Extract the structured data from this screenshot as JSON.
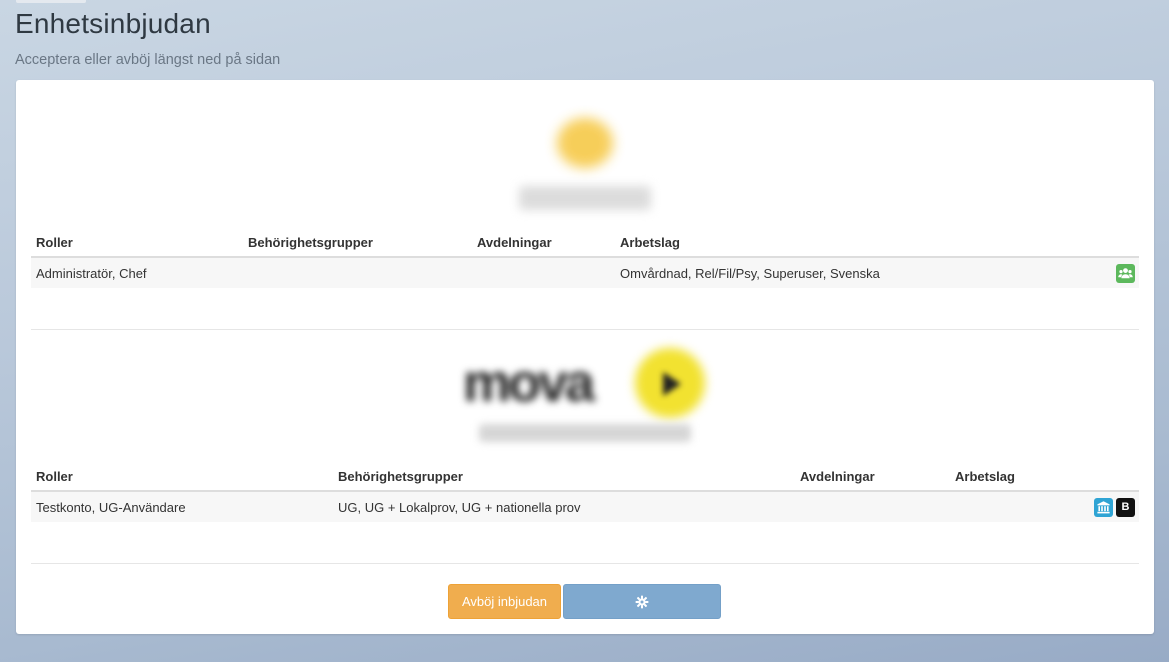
{
  "page": {
    "title": "Enhetsinbjudan",
    "subtitle": "Acceptera eller avböj längst ned på sidan"
  },
  "units": [
    {
      "columns": [
        "Roller",
        "Behörighetsgrupper",
        "Avdelningar",
        "Arbetslag"
      ],
      "row": {
        "roller": "Administratör, Chef",
        "behorighetsgrupper": "",
        "avdelningar": "",
        "arbetslag": "Omvårdnad, Rel/Fil/Psy, Superuser, Svenska"
      },
      "icons": [
        "users-icon"
      ]
    },
    {
      "columns": [
        "Roller",
        "Behörighetsgrupper",
        "Avdelningar",
        "Arbetslag"
      ],
      "row": {
        "roller": "Testkonto, UG-Användare",
        "behorighetsgrupper": "UG, UG + Lokalprov, UG + nationella prov",
        "avdelningar": "",
        "arbetslag": ""
      },
      "icons": [
        "bank-icon",
        "b-badge-icon"
      ],
      "badge_letter": "B"
    }
  ],
  "actions": {
    "decline_label": "Avböj inbjudan",
    "accept_icon": "gear-icon"
  },
  "colors": {
    "decline": "#f0ad4e",
    "accept": "#7fa9cf",
    "green_badge": "#5cb85c",
    "blue_badge": "#2fa4d4"
  }
}
